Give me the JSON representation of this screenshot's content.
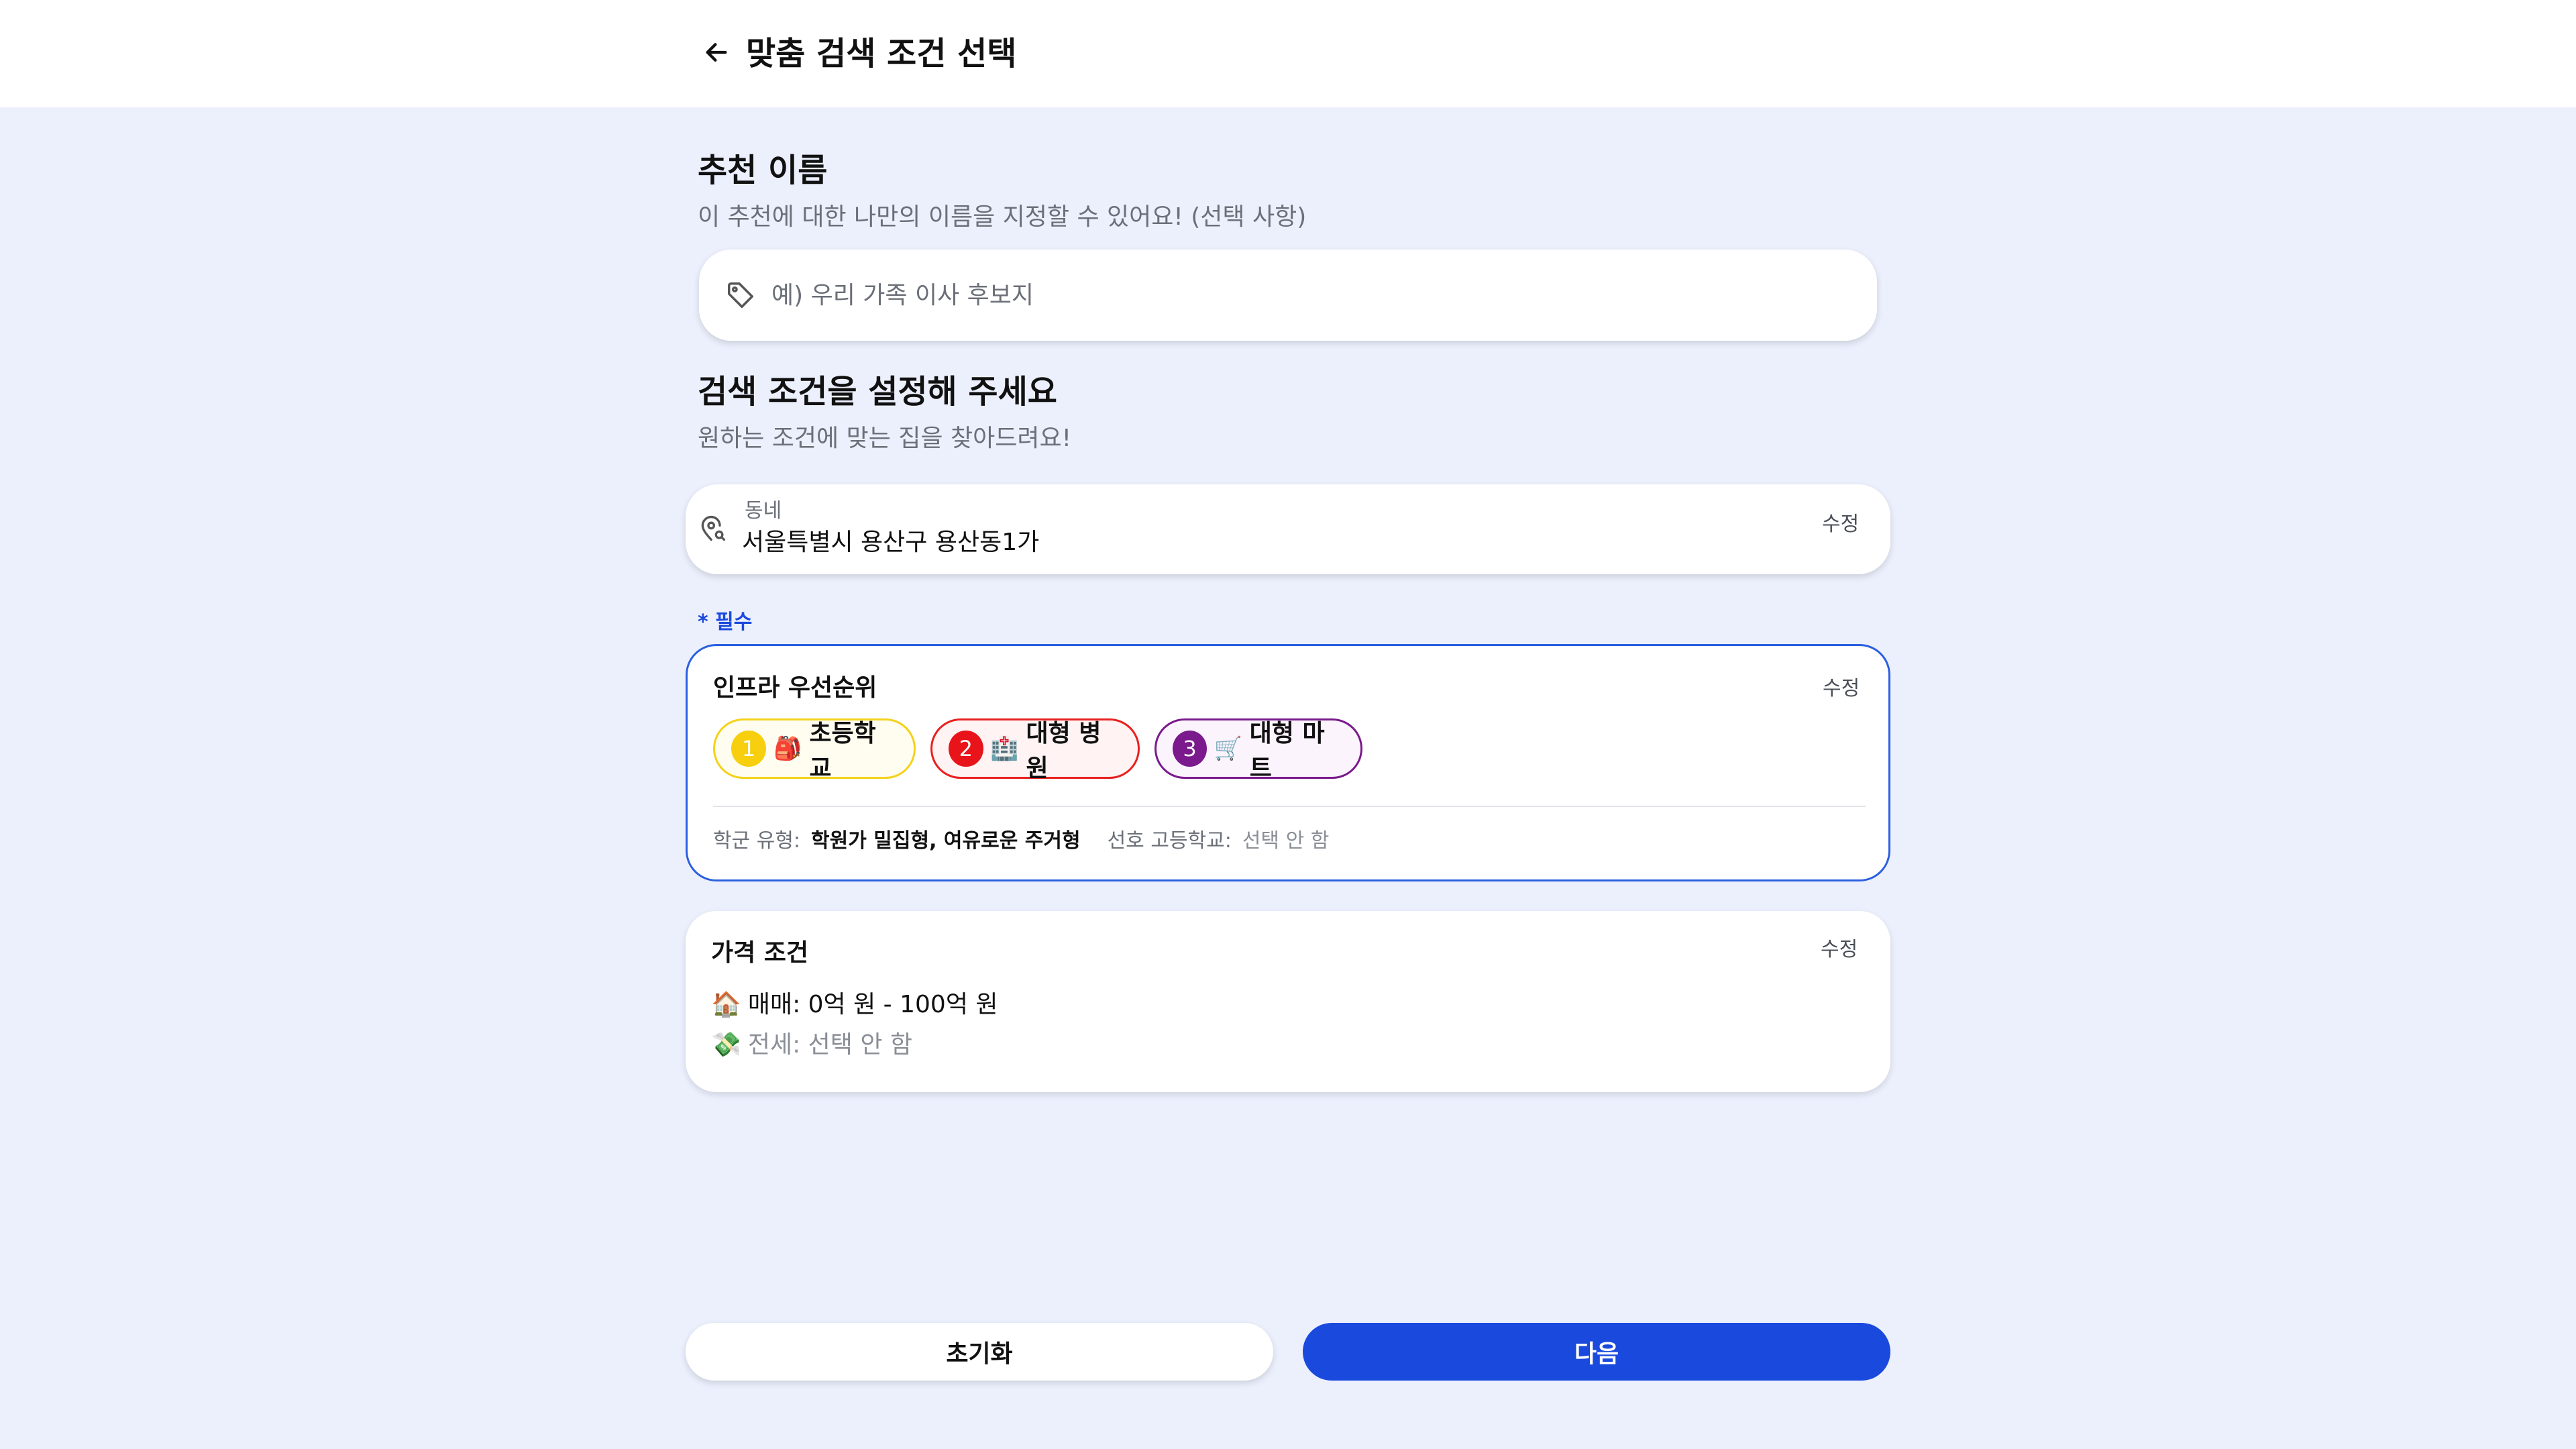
{
  "header": {
    "title": "맞춤 검색 조건 선택",
    "back_icon": "arrow-left-icon"
  },
  "recommend_name": {
    "title": "추천 이름",
    "subtitle": "이 추천에 대한 나만의 이름을 지정할 수 있어요! (선택 사항)",
    "icon": "tag-icon",
    "placeholder": "예) 우리 가족 이사 후보지",
    "value": ""
  },
  "search_conditions": {
    "title": "검색 조건을 설정해 주세요",
    "subtitle": "원하는 조건에 맞는 집을 찾아드려요!"
  },
  "neighborhood": {
    "icon": "location-pin-icon",
    "label": "동네",
    "value": "서울특별시 용산구 용산동1가",
    "edit_label": "수정"
  },
  "required_note": "* 필수",
  "infra": {
    "title": "인프라 우선순위",
    "edit_label": "수정",
    "priorities": [
      {
        "rank": "1",
        "emoji": "🎒",
        "label": "초등학교",
        "color": "#f7cf0e"
      },
      {
        "rank": "2",
        "emoji": "🏥",
        "label": "대형 병원",
        "color": "#e8141a"
      },
      {
        "rank": "3",
        "emoji": "🛒",
        "label": "대형 마트",
        "color": "#7a1a8c"
      }
    ],
    "school_type_label": "학군 유형:",
    "school_type_value": "학원가 밀집형, 여유로운 주거형",
    "high_school_label": "선호 고등학교:",
    "high_school_value": "선택 안 함"
  },
  "price": {
    "title": "가격 조건",
    "edit_label": "수정",
    "sale_emoji": "🏠",
    "sale_text": "매매: 0억 원 - 100억 원",
    "jeonse_emoji": "💸",
    "jeonse_text": "전세: 선택 안 함"
  },
  "buttons": {
    "reset": "초기화",
    "next": "다음"
  },
  "colors": {
    "accent": "#1a49de",
    "background": "#ecf0fd"
  }
}
